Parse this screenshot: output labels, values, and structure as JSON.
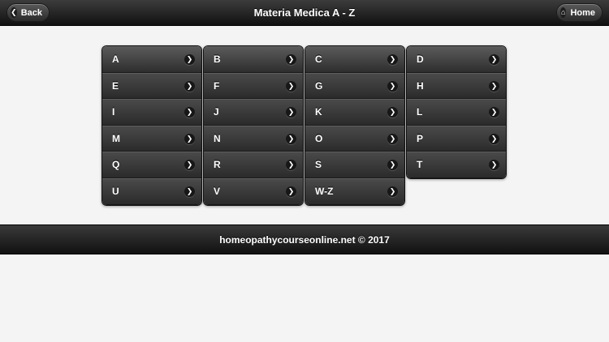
{
  "header": {
    "title": "Materia Medica A - Z",
    "back_label": "Back",
    "home_label": "Home"
  },
  "columns": [
    [
      "A",
      "E",
      "I",
      "M",
      "Q",
      "U"
    ],
    [
      "B",
      "F",
      "J",
      "N",
      "R",
      "V"
    ],
    [
      "C",
      "G",
      "K",
      "O",
      "S",
      "W-Z"
    ],
    [
      "D",
      "H",
      "L",
      "P",
      "T"
    ]
  ],
  "footer": {
    "text": "homeopathycourseonline.net © 2017"
  }
}
